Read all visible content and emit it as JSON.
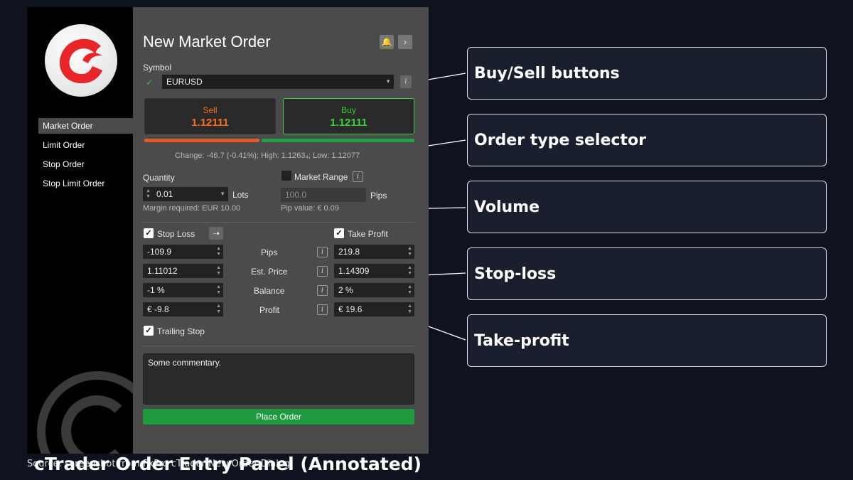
{
  "panel": {
    "title": "New Market Order",
    "symbol_label": "Symbol",
    "symbol_value": "EURUSD",
    "sell": {
      "label": "Sell",
      "price": "1.12111"
    },
    "buy": {
      "label": "Buy",
      "price": "1.12111"
    },
    "stats": "Change: -46.7 (-0.41%); High: 1.1263₄; Low: 1.12077",
    "quantity_label": "Quantity",
    "quantity_value": "0.01",
    "quantity_unit": "Lots",
    "margin": "Margin required: EUR 10.00",
    "market_range_label": "Market Range",
    "range_value": "100.0",
    "range_unit": "Pips",
    "pip_value": "Pip value: € 0.09",
    "stop_loss_label": "Stop Loss",
    "take_profit_label": "Take Profit",
    "rows": [
      {
        "label": "Pips",
        "sl": "-109.9",
        "tp": "219.8"
      },
      {
        "label": "Est. Price",
        "sl": "1.11012",
        "tp": "1.14309"
      },
      {
        "label": "Balance",
        "sl": "-1 %",
        "tp": "2 %"
      },
      {
        "label": "Profit",
        "sl": "€ -9.8",
        "tp": "€ 19.6"
      }
    ],
    "trailing_stop_label": "Trailing Stop",
    "comment": "Some commentary.",
    "place_order_label": "Place Order"
  },
  "sidebar": {
    "items": [
      "Market Order",
      "Limit Order",
      "Stop Order",
      "Stop Limit Order"
    ],
    "active_index": 0
  },
  "callouts": [
    "Buy/Sell buttons",
    "Order type selector",
    "Volume",
    "Stop-loss",
    "Take-profit"
  ],
  "caption": "cTrader Order Entry Panel (Annotated)",
  "source": "Source: screenshot from FxPro cTrader New Order Dialog",
  "colors": {
    "sell": "#ff6a1a",
    "buy": "#3bcf3b",
    "place_order": "#1f9a3e",
    "sell_bar": "#e05a25",
    "buy_bar": "#23a048",
    "logo_red": "#e8262a"
  }
}
